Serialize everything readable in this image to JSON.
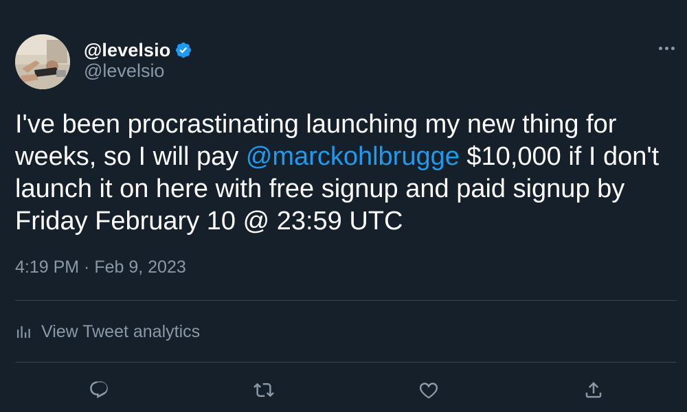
{
  "tweet": {
    "author": {
      "display_name": "@levelsio",
      "handle": "@levelsio",
      "verified": true,
      "avatar_icon": "avatar-photo"
    },
    "more_icon": "more-options-icon",
    "body": {
      "part1": "I've been procrastinating launching my new thing for weeks, so I will pay ",
      "mention": "@marckohlbrugge",
      "part2": " $10,000 if I don't launch it on here with free signup and paid signup by Friday February 10 @ 23:59 UTC"
    },
    "timestamp": "4:19 PM · Feb 9, 2023",
    "analytics_label": "View Tweet analytics",
    "actions": [
      {
        "name": "reply",
        "icon": "reply-icon"
      },
      {
        "name": "retweet",
        "icon": "retweet-icon"
      },
      {
        "name": "like",
        "icon": "like-icon"
      },
      {
        "name": "share",
        "icon": "share-icon"
      }
    ]
  },
  "colors": {
    "background": "#15202b",
    "text_primary": "#ffffff",
    "text_secondary": "#8b98a5",
    "accent": "#1d9bf0",
    "divider": "#38444d"
  }
}
